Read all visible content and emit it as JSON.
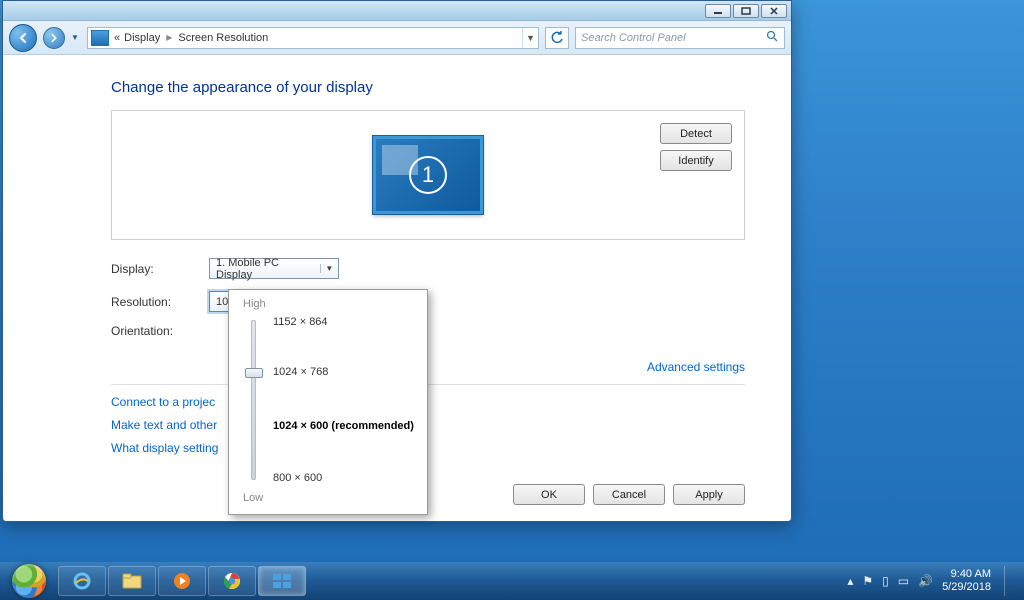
{
  "window": {
    "breadcrumb": {
      "root_symbol": "«",
      "item1": "Display",
      "item2": "Screen Resolution"
    },
    "search_placeholder": "Search Control Panel"
  },
  "page": {
    "heading": "Change the appearance of your display",
    "detect": "Detect",
    "identify": "Identify",
    "monitor_number": "1",
    "labels": {
      "display": "Display:",
      "resolution": "Resolution:",
      "orientation": "Orientation:"
    },
    "display_value": "1. Mobile PC Display",
    "resolution_value": "1024 × 768",
    "advanced": "Advanced settings",
    "links": {
      "projector": "Connect to a projec",
      "text": "Make text and other",
      "what": "What display setting"
    },
    "buttons": {
      "ok": "OK",
      "cancel": "Cancel",
      "apply": "Apply"
    }
  },
  "res_popup": {
    "high": "High",
    "low": "Low",
    "options": [
      "1152 × 864",
      "1024 × 768",
      "1024 × 600 (recommended)",
      "800 × 600"
    ],
    "selected_index": 1
  },
  "taskbar": {
    "time": "9:40 AM",
    "date": "5/29/2018"
  }
}
